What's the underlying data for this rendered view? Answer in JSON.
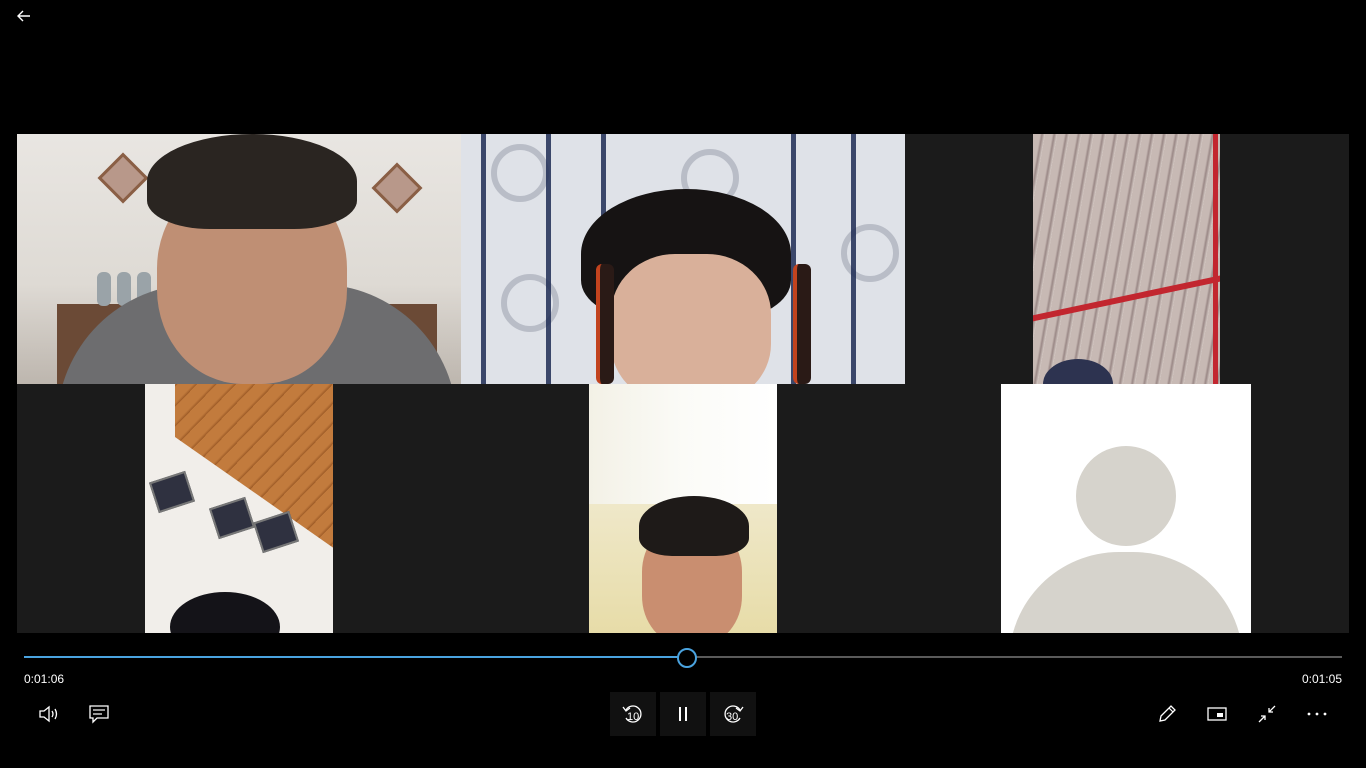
{
  "app": {
    "back_icon": "arrow-left-icon"
  },
  "player": {
    "progress": 0.5023,
    "time_elapsed": "0:01:06",
    "time_remaining": "0:01:05",
    "accent_color": "#4aa3df"
  },
  "controls": {
    "volume_icon": "volume-icon",
    "captions_icon": "captions-icon",
    "skip_back_label": "10",
    "play_pause_icon": "pause-icon",
    "skip_forward_label": "30",
    "edit_icon": "pencil-icon",
    "mini_view_icon": "mini-view-icon",
    "exit_fullscreen_icon": "exit-fullscreen-icon",
    "more_icon": "more-icon"
  },
  "video": {
    "participants": 6
  }
}
